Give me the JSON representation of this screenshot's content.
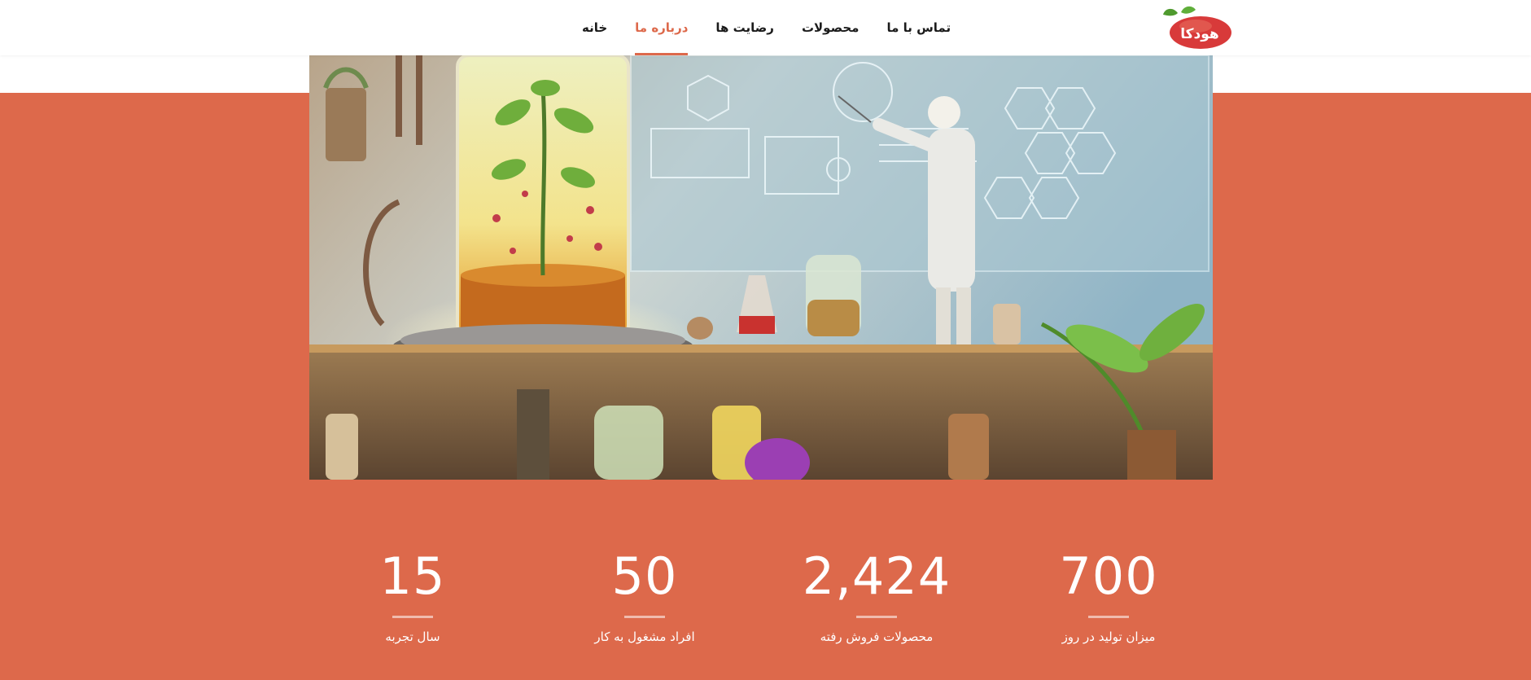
{
  "brand": {
    "logo_text": "هودکا",
    "primary_color": "#dd694b"
  },
  "nav": {
    "items": [
      {
        "label": "خانه"
      },
      {
        "label": "درباره ما",
        "active": true
      },
      {
        "label": "رضایت ها"
      },
      {
        "label": "محصولات"
      },
      {
        "label": "تماس با ما"
      }
    ]
  },
  "hero": {
    "image": "laboratory-illustration"
  },
  "stats": [
    {
      "value": "700",
      "label": "میزان تولید در روز"
    },
    {
      "value": "2,424",
      "label": "محصولات فروش رفته"
    },
    {
      "value": "50",
      "label": "افراد مشغول به کار"
    },
    {
      "value": "15",
      "label": "سال تجربه"
    }
  ]
}
